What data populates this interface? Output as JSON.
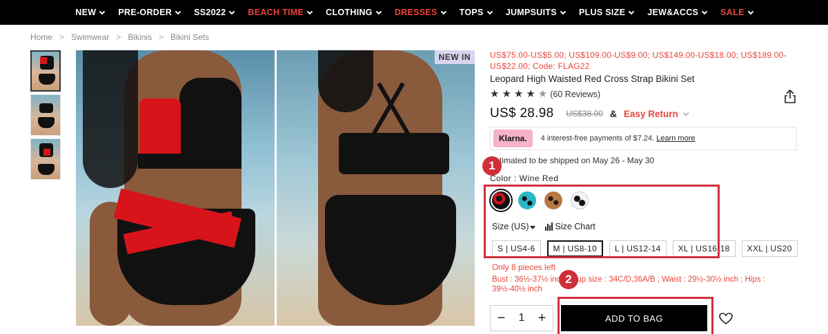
{
  "nav": [
    {
      "label": "NEW",
      "color": "#ffffff"
    },
    {
      "label": "PRE-ORDER",
      "color": "#ffffff"
    },
    {
      "label": "SS2022",
      "color": "#ffffff"
    },
    {
      "label": "BEACH TIME",
      "color": "#e8443a"
    },
    {
      "label": "CLOTHING",
      "color": "#ffffff"
    },
    {
      "label": "DRESSES",
      "color": "#e8443a"
    },
    {
      "label": "TOPS",
      "color": "#ffffff"
    },
    {
      "label": "JUMPSUITS",
      "color": "#ffffff"
    },
    {
      "label": "PLUS SIZE",
      "color": "#ffffff"
    },
    {
      "label": "JEW&ACCS",
      "color": "#ffffff"
    },
    {
      "label": "SALE",
      "color": "#e8443a"
    }
  ],
  "breadcrumb": [
    "Home",
    "Swimwear",
    "Bikinis",
    "Bikini Sets"
  ],
  "breadcrumb_separator": ">",
  "badge": "NEW IN",
  "promo": "US$75.00-US$5.00;  US$109.00-US$9.00;  US$149.00-US$18.00;  US$189.00-US$22.00;  Code:  FLAG22",
  "product_title": "Leopard High Waisted Red Cross Strap Bikini Set",
  "rating": {
    "stars": 4.5,
    "reviews": "(60 Reviews)"
  },
  "price": "US$ 28.98",
  "original_price": "US$38.00",
  "ampersand": "&",
  "easy_return": "Easy Return",
  "klarna": {
    "logo": "Klarna.",
    "text": "4 interest-free payments of $7.24.",
    "link": "Learn more"
  },
  "shipping": "Estimated to be shipped on May 26 - May 30",
  "color_label": "Color : Wine Red",
  "swatches": [
    "wine-red",
    "blue-leopard",
    "brown-leopard",
    "white-leopard"
  ],
  "size_label": "Size (US)",
  "size_chart": "Size Chart",
  "sizes": [
    "S | US4-6",
    "M | US8-10",
    "L | US12-14",
    "XL | US16-18",
    "XXL | US20"
  ],
  "selected_size": "M | US8-10",
  "stock": "Only 8 pieces left",
  "measurements": "Bust : 36½-37½ inch ; Cup size : 34C/D,36A/B ; Waist : 29½-30½ inch ; Hips : 39½-40½ inch",
  "quantity": "1",
  "qty_minus": "−",
  "qty_plus": "+",
  "add_to_bag": "ADD TO BAG",
  "annotations": [
    "1",
    "2"
  ],
  "colors": {
    "accent": "#e8443a",
    "annotation": "#d02f3a",
    "klarna": "#f6b3c7"
  }
}
